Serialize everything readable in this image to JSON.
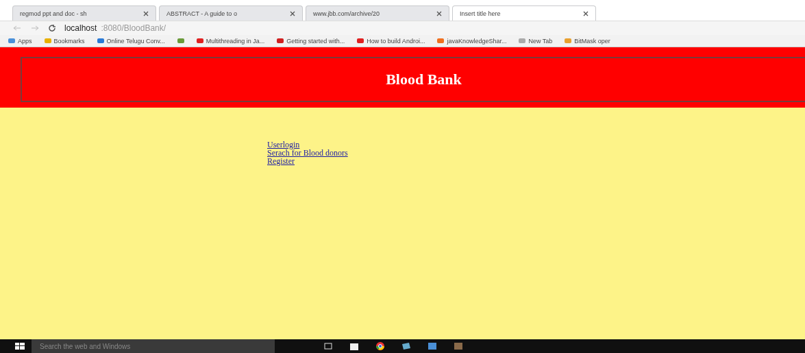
{
  "tabs": [
    {
      "title": "regmod ppt and doc - sh",
      "selected": false
    },
    {
      "title": "ABSTRACT - A guide to o",
      "selected": false
    },
    {
      "title": "www.jbb.com/archive/20",
      "selected": false
    },
    {
      "title": "Insert title here",
      "selected": true
    }
  ],
  "address": {
    "host": "localhost",
    "path": ":8080/BloodBank/"
  },
  "bookmarks": [
    {
      "kind": "link",
      "label": "Apps"
    },
    {
      "kind": "link",
      "label": "Bookmarks"
    },
    {
      "kind": "link",
      "label": "Online Telugu Conv..."
    },
    {
      "kind": "icon"
    },
    {
      "kind": "link",
      "label": "Multithreading in Ja..."
    },
    {
      "kind": "link",
      "label": "Getting started with..."
    },
    {
      "kind": "link",
      "label": "How to build Androi..."
    },
    {
      "kind": "link",
      "label": "javaKnowledgeShar..."
    },
    {
      "kind": "link",
      "label": "New Tab"
    },
    {
      "kind": "link",
      "label": "BitMask oper"
    }
  ],
  "header": {
    "title": "Blood Bank"
  },
  "links": [
    "Userlogin",
    "Serach for Blood donors",
    "Register"
  ],
  "taskbar": {
    "search_placeholder": "Search the web and Windows"
  }
}
